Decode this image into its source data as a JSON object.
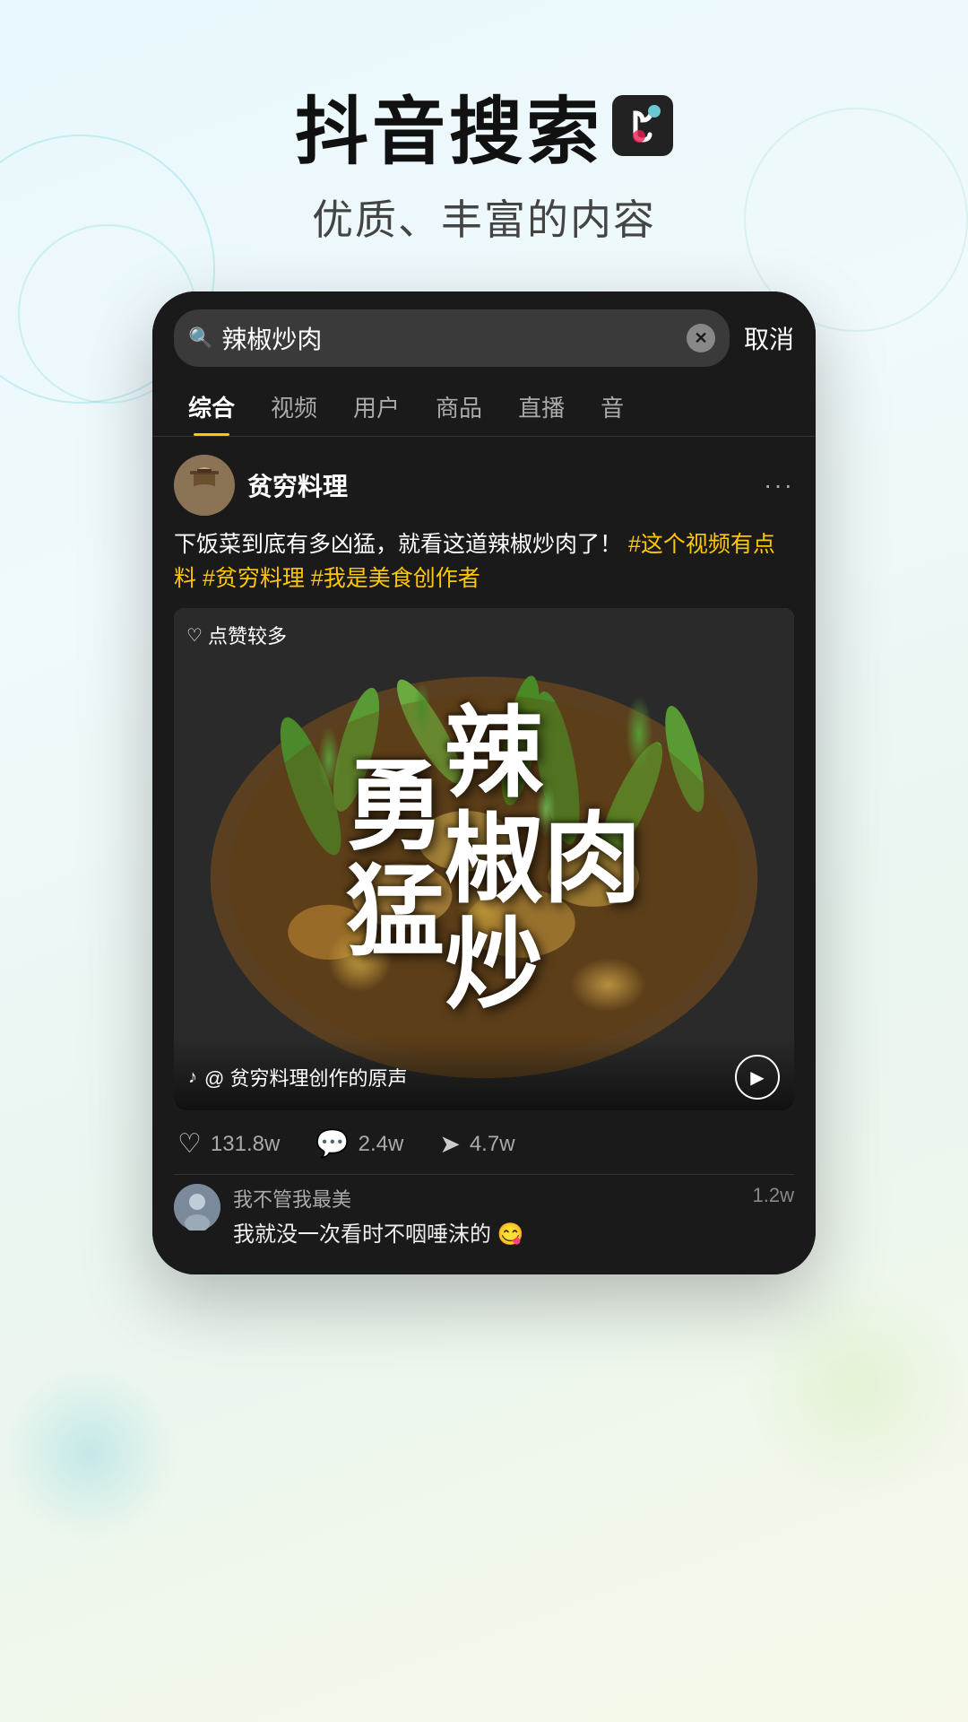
{
  "page": {
    "background": "gradient-light-blue-green"
  },
  "header": {
    "main_title": "抖音搜索",
    "subtitle": "优质、丰富的内容",
    "logo_alt": "TikTok logo"
  },
  "phone": {
    "search_bar": {
      "query": "辣椒炒肉",
      "cancel_label": "取消",
      "placeholder": "搜索"
    },
    "tabs": [
      {
        "label": "综合",
        "active": true
      },
      {
        "label": "视频",
        "active": false
      },
      {
        "label": "用户",
        "active": false
      },
      {
        "label": "商品",
        "active": false
      },
      {
        "label": "直播",
        "active": false
      },
      {
        "label": "音",
        "active": false
      }
    ],
    "post": {
      "username": "贫穷料理",
      "verified": true,
      "text_plain": "下饭菜到底有多凶猛，就看这道辣椒炒肉了！",
      "hashtags": "#这个视频有点料 #贫穷料理 #我是美食创作者",
      "video": {
        "likes_badge": "点赞较多",
        "big_text": "勇猛辣椒炒肉",
        "audio_label": "@ 贫穷料理创作的原声"
      },
      "interactions": [
        {
          "type": "like",
          "count": "131.8w",
          "icon": "♡"
        },
        {
          "type": "comment",
          "count": "2.4w",
          "icon": "💬"
        },
        {
          "type": "share",
          "count": "4.7w",
          "icon": "↗"
        }
      ],
      "comment_preview": {
        "author": "我不管我最美",
        "text": "我就没一次看时不咽唾沫的 😋",
        "count": "1.2w"
      }
    }
  }
}
